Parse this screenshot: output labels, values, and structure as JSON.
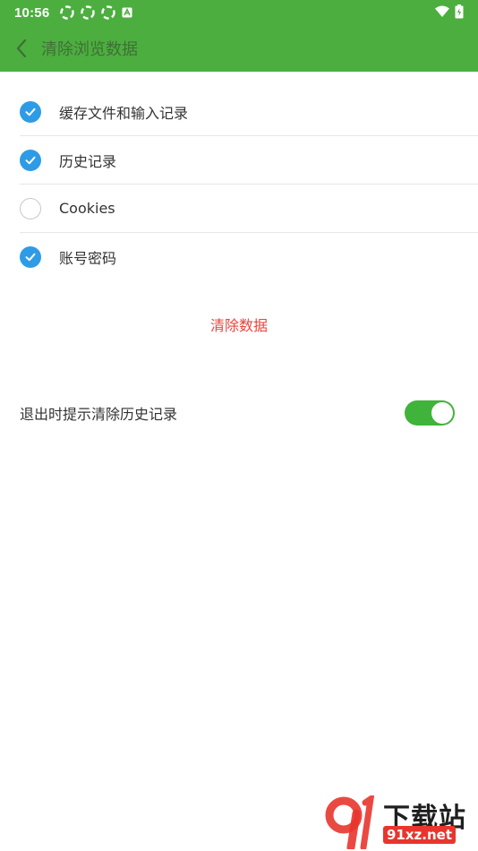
{
  "status_bar": {
    "time": "10:56",
    "icons": [
      "sync-icon",
      "sync-icon",
      "sync-icon",
      "a-badge-icon",
      "wifi-icon",
      "battery-icon"
    ]
  },
  "app_bar": {
    "title": "清除浏览数据",
    "back_icon": "chevron-left-icon"
  },
  "options": [
    {
      "label": "缓存文件和输入记录",
      "checked": true
    },
    {
      "label": "历史记录",
      "checked": true
    },
    {
      "label": "Cookies",
      "checked": false
    },
    {
      "label": "账号密码",
      "checked": true
    }
  ],
  "clear_button": {
    "label": "清除数据"
  },
  "exit_prompt": {
    "label": "退出时提示清除历史记录",
    "enabled": true
  },
  "watermark": {
    "cn": "下载站",
    "url": "91xz.net"
  },
  "colors": {
    "header": "#4cae3f",
    "check": "#2e9be6",
    "danger": "#e8453c",
    "toggle": "#3fb33a"
  }
}
